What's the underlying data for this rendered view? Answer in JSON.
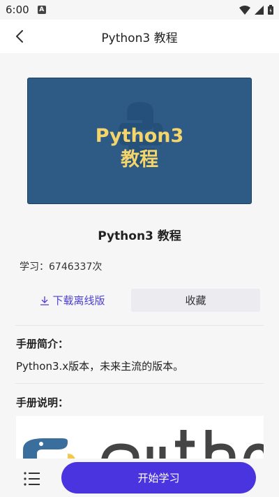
{
  "status_bar": {
    "time": "6:00",
    "notification_badge": "A"
  },
  "header": {
    "title": "Python3 教程"
  },
  "cover": {
    "line1": "Python3",
    "line2": "教程",
    "bg_color": "#2d5b86",
    "text_color": "#f5d56a"
  },
  "book": {
    "title": "Python3 教程",
    "study_count": "学习：6746337次",
    "download_label": "下载离线版",
    "favorite_label": "收藏"
  },
  "sections": {
    "intro_heading": "手册简介：",
    "intro_text": "Python3.x版本，未来主流的版本。",
    "manual_heading": "手册说明："
  },
  "bottom": {
    "start_label": "开始学习",
    "accent": "#4a34e0"
  }
}
